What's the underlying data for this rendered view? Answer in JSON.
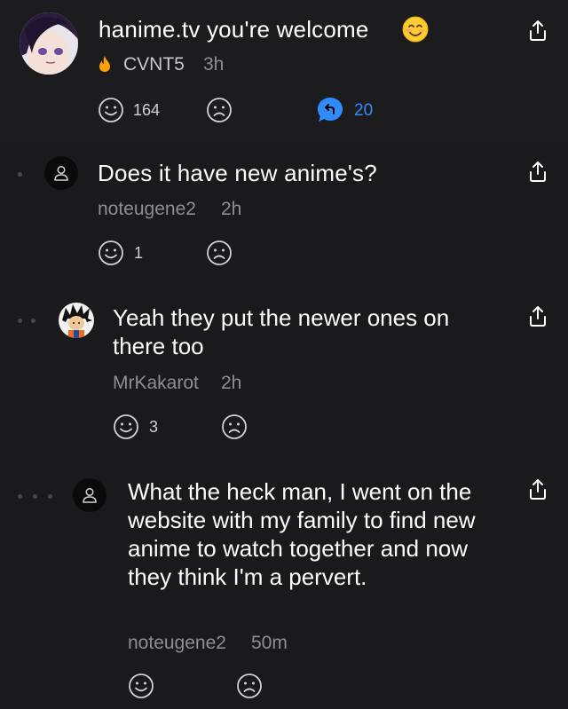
{
  "top_comment": {
    "title": "hanime.tv you're welcome",
    "emoji_name": "smiling-face-emoji",
    "badge_icon": "fire-icon",
    "username": "CVNT5",
    "time": "3h",
    "likes": "164",
    "replies": "20"
  },
  "reply1": {
    "text": "Does it have new anime's?",
    "username": "noteugene2",
    "time": "2h",
    "likes": "1"
  },
  "reply2": {
    "text": "Yeah they put the newer ones on there too",
    "username": "MrKakarot",
    "time": "2h",
    "likes": "3"
  },
  "reply3": {
    "text": "What the heck man, I went on the website with my family to find new anime to watch together and now they think I'm a pervert.",
    "username": "noteugene2",
    "time": "50m"
  },
  "colors": {
    "accent_blue": "#2f8cff",
    "fire_orange": "#ff9f0a",
    "background": "#1c1c1e",
    "muted_text": "#8e8e93"
  }
}
